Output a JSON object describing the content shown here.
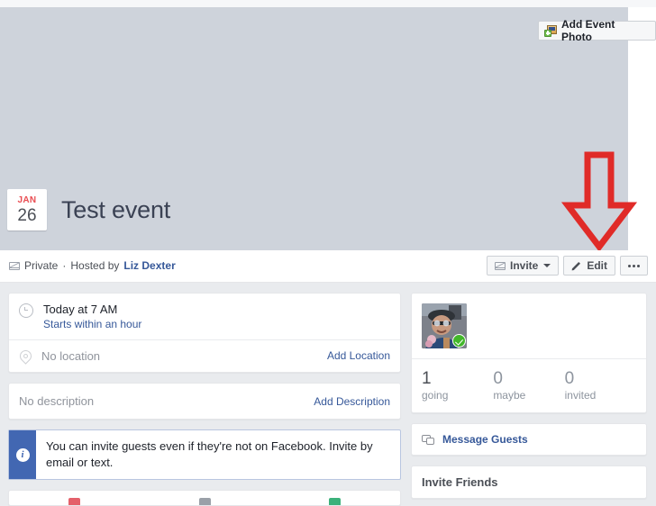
{
  "cover": {
    "add_photo_label": "Add Event Photo",
    "add_photo_icon": "add-photo-icon",
    "background_color": "#ced3db"
  },
  "annotation": {
    "type": "down-arrow",
    "color": "#e02b28",
    "points_at": "edit-button"
  },
  "event": {
    "date": {
      "month": "JAN",
      "day": "26"
    },
    "title": "Test event",
    "privacy": "Private",
    "separator": "·",
    "hosted_by_label": "Hosted by",
    "host_name": "Liz Dexter"
  },
  "toolbar": {
    "invite_label": "Invite",
    "invite_icon": "envelope-icon",
    "edit_label": "Edit",
    "edit_icon": "pencil-icon",
    "more_icon": "ellipsis-icon"
  },
  "details": {
    "time": {
      "icon": "clock-icon",
      "title": "Today at 7 AM",
      "sub": "Starts within an hour"
    },
    "location": {
      "icon": "location-pin-icon",
      "text": "No location",
      "action": "Add Location"
    },
    "description": {
      "text": "No description",
      "action": "Add Description"
    }
  },
  "banner": {
    "icon": "info-icon",
    "text": "You can invite guests even if they're not on Facebook. Invite by email or text.",
    "accent_color": "#4267b2"
  },
  "guests": {
    "avatar_alt": "guest-avatar",
    "attending_badge": "going-check-icon",
    "counts": [
      {
        "num": "1",
        "label": "going"
      },
      {
        "num": "0",
        "label": "maybe"
      },
      {
        "num": "0",
        "label": "invited"
      }
    ],
    "message_guests_label": "Message Guests",
    "message_guests_icon": "chat-bubbles-icon"
  },
  "invite_friends": {
    "heading": "Invite Friends"
  }
}
